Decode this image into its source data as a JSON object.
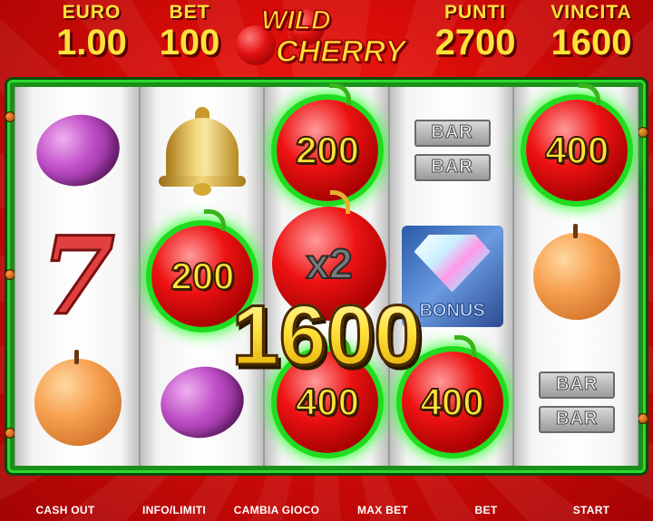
{
  "header": {
    "euro_label": "EURO",
    "euro_value": "1.00",
    "bet_label": "BET",
    "bet_value": "100",
    "punti_label": "PUNTI",
    "punti_value": "2700",
    "vincita_label": "VINCITA",
    "vincita_value": "1600"
  },
  "logo": {
    "line1": "WILD",
    "line2": "CHERRY"
  },
  "reels": {
    "r2_top_value": "200",
    "r5_top_value": "400",
    "r2_mid_value": "200",
    "r3_bottom_value": "400",
    "r4_bottom_value": "400",
    "bar_label": "BAR",
    "bonus_label": "BONUS",
    "multiplier": "x2"
  },
  "total_win": "1600",
  "buttons": {
    "cash_out": "CASH OUT",
    "info": "INFO/LIMITI",
    "change_game": "CAMBIA GIOCO",
    "max_bet": "MAX BET",
    "bet": "BET",
    "start": "START"
  },
  "colors": {
    "accent_yellow": "#ffe23a",
    "win_green": "#1fdc1f",
    "background_red": "#d80c08"
  }
}
